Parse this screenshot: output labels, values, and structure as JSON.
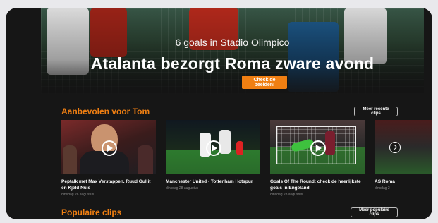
{
  "hero": {
    "subtitle": "6 goals in Stadio Olimpico",
    "title": "Atalanta bezorgt Roma zware avond",
    "button": "Check de beelden!"
  },
  "recommended": {
    "heading": "Aanbevolen voor Tom",
    "more_button": "Meer recente clips",
    "cards": [
      {
        "title": "Peptalk met Max Verstappen, Ruud Gullit en Kjeld Nuis",
        "date": "dinsdag 26 augustus"
      },
      {
        "title": "Manchester United - Tottenham Hotspur",
        "date": "dinsdag 28 augustus"
      },
      {
        "title": "Goals Of The Round: check de heerlijkste goals in Engeland",
        "date": "dinsdag 28 augustus"
      },
      {
        "title": "AS Roma",
        "date": "dinsdag 2"
      }
    ]
  },
  "popular": {
    "heading": "Populaire clips",
    "more_button": "Meer populaire clips"
  },
  "icons": {
    "play": "play-circle-icon",
    "next": "chevron-right-circle-icon"
  },
  "colors": {
    "accent": "#f07f12",
    "background": "#161616"
  }
}
